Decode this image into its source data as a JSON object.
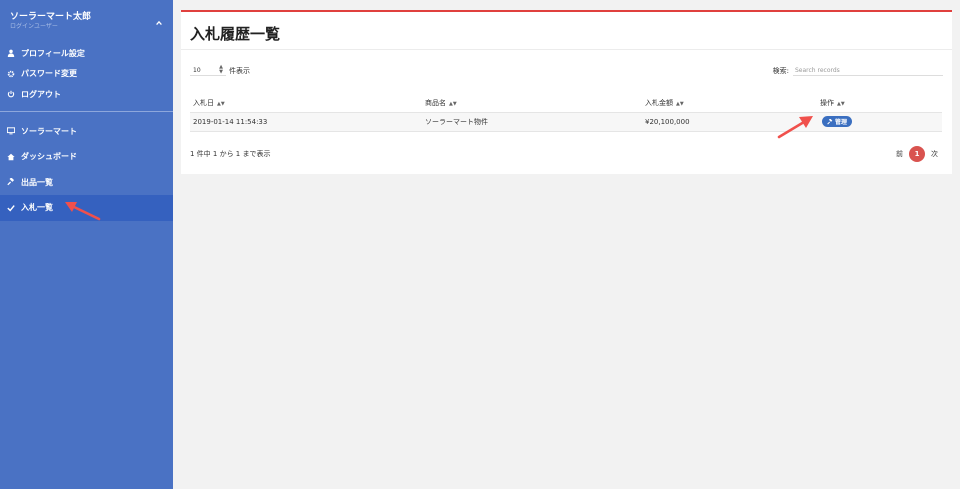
{
  "sidebar": {
    "user": {
      "name": "ソーラーマート太郎",
      "role": "ログインユーザー"
    },
    "account_menu": [
      {
        "label": "プロフィール設定",
        "icon": "user-icon"
      },
      {
        "label": "パスワード変更",
        "icon": "gear-icon"
      },
      {
        "label": "ログアウト",
        "icon": "power-icon"
      }
    ],
    "main_menu": [
      {
        "label": "ソーラーマート",
        "icon": "desktop-icon"
      },
      {
        "label": "ダッシュボード",
        "icon": "home-icon"
      },
      {
        "label": "出品一覧",
        "icon": "gavel-icon"
      },
      {
        "label": "入札一覧",
        "icon": "check-icon",
        "active": true
      }
    ]
  },
  "page": {
    "title": "入札履歴一覧",
    "length": {
      "value": "10",
      "suffix": "件表示"
    },
    "search": {
      "label": "検索:",
      "placeholder": "Search records"
    },
    "table": {
      "headers": [
        "入札日",
        "商品名",
        "入札金額",
        "操作"
      ],
      "rows": [
        {
          "date": "2019-01-14 11:54:33",
          "name": "ソーラーマート物件",
          "amount": "¥20,100,000",
          "action": "管理"
        }
      ]
    },
    "info": "1 件中 1 から 1 まで表示",
    "pager": {
      "prev": "前",
      "current": "1",
      "next": "次"
    }
  },
  "colors": {
    "sidebar": "#4a72c4",
    "sidebar_active": "#3561bf",
    "accent_red": "#e0403e",
    "button_blue": "#3b6fc0",
    "arrow": "#f0504c"
  }
}
